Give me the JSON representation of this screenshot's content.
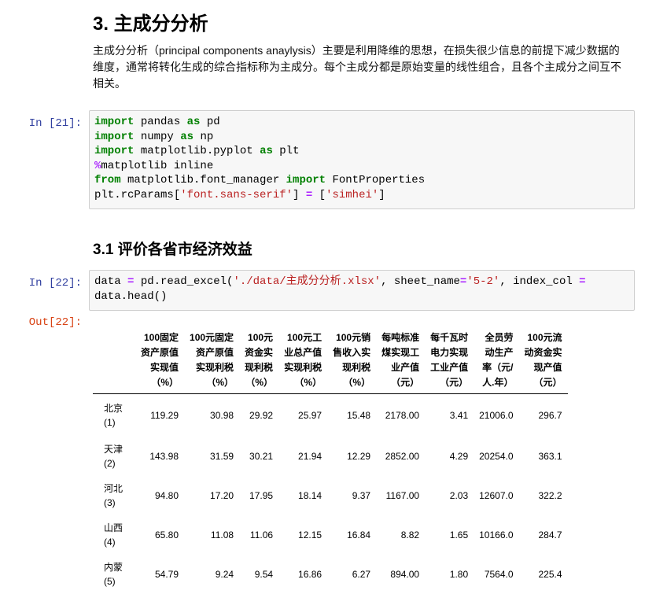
{
  "markdown": {
    "heading3": "3. 主成分分析",
    "paragraph": "主成分分析（principal components anaylysis）主要是利用降维的思想，在损失很少信息的前提下减少数据的维度，通常将转化生成的综合指标称为主成分。每个主成分都是原始变量的线性组合，且各个主成分之间互不相关。",
    "heading4": "3.1 评价各省市经济效益"
  },
  "cell21": {
    "prompt": "In [21]:",
    "lines": [
      [
        {
          "t": "import",
          "c": "kw"
        },
        {
          "t": " pandas "
        },
        {
          "t": "as",
          "c": "kw"
        },
        {
          "t": " pd"
        }
      ],
      [
        {
          "t": "import",
          "c": "kw"
        },
        {
          "t": " numpy "
        },
        {
          "t": "as",
          "c": "kw"
        },
        {
          "t": " np"
        }
      ],
      [
        {
          "t": "import",
          "c": "kw"
        },
        {
          "t": " matplotlib.pyplot "
        },
        {
          "t": "as",
          "c": "kw"
        },
        {
          "t": " plt"
        }
      ],
      [
        {
          "t": "%",
          "c": "op"
        },
        {
          "t": "matplotlib inline"
        }
      ],
      [
        {
          "t": "from",
          "c": "kw"
        },
        {
          "t": " matplotlib.font_manager "
        },
        {
          "t": "import",
          "c": "kw"
        },
        {
          "t": " FontProperties"
        }
      ],
      [
        {
          "t": "plt.rcParams["
        },
        {
          "t": "'font.sans-serif'",
          "c": "str"
        },
        {
          "t": "] "
        },
        {
          "t": "=",
          "c": "op"
        },
        {
          "t": " ["
        },
        {
          "t": "'simhei'",
          "c": "str"
        },
        {
          "t": "]"
        }
      ]
    ]
  },
  "cell22": {
    "prompt": "In [22]:",
    "out_prompt": "Out[22]:",
    "lines": [
      [
        {
          "t": "data "
        },
        {
          "t": "=",
          "c": "op"
        },
        {
          "t": " pd.read_excel("
        },
        {
          "t": "'./data/主成分分析.xlsx'",
          "c": "str"
        },
        {
          "t": ", sheet_name"
        },
        {
          "t": "=",
          "c": "op"
        },
        {
          "t": "'5-2'",
          "c": "str"
        },
        {
          "t": ", index_col "
        },
        {
          "t": "=",
          "c": "op"
        }
      ],
      [
        {
          "t": "data.head()"
        }
      ]
    ]
  },
  "dataframe": {
    "columns": [
      "100固定\n资产原值\n实现值\n（%）",
      "100元固定\n资产原值\n实现利税\n（%）",
      "100元\n资金实\n现利税\n（%）",
      "100元工\n业总产值\n实现利税\n（%）",
      "100元销\n售收入实\n现利税\n（%）",
      "每吨标准\n煤实现工\n业产值\n（元）",
      "每千瓦时\n电力实现\n工业产值\n（元）",
      "全员劳\n动生产\n率（元/\n人.年）",
      "100元流\n动资金实\n现产值\n（元）"
    ],
    "rows": [
      {
        "index": "北京\n(1)",
        "values": [
          "119.29",
          "30.98",
          "29.92",
          "25.97",
          "15.48",
          "2178.00",
          "3.41",
          "21006.0",
          "296.7"
        ]
      },
      {
        "index": "天津\n(2)",
        "values": [
          "143.98",
          "31.59",
          "30.21",
          "21.94",
          "12.29",
          "2852.00",
          "4.29",
          "20254.0",
          "363.1"
        ]
      },
      {
        "index": "河北\n(3)",
        "values": [
          "94.80",
          "17.20",
          "17.95",
          "18.14",
          "9.37",
          "1167.00",
          "2.03",
          "12607.0",
          "322.2"
        ]
      },
      {
        "index": "山西\n(4)",
        "values": [
          "65.80",
          "11.08",
          "11.06",
          "12.15",
          "16.84",
          "8.82",
          "1.65",
          "10166.0",
          "284.7"
        ]
      },
      {
        "index": "内蒙\n(5)",
        "values": [
          "54.79",
          "9.24",
          "9.54",
          "16.86",
          "6.27",
          "894.00",
          "1.80",
          "7564.0",
          "225.4"
        ]
      }
    ]
  }
}
